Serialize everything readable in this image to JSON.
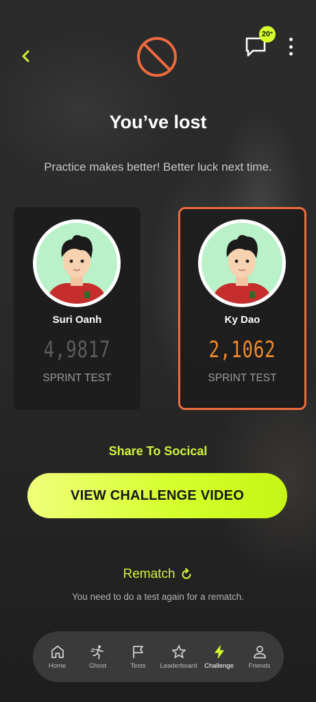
{
  "header": {
    "back_icon": "chevron-left-icon",
    "status_icon": "prohibited-icon",
    "chat_icon": "chat-bubble-icon",
    "chat_badge": "20",
    "chat_badge_sup": "+",
    "menu_icon": "vertical-dots-icon"
  },
  "result": {
    "title": "You’ve lost",
    "subtitle": "Practice makes better! Better luck next time."
  },
  "players": [
    {
      "name": "Suri Oanh",
      "score": "4,9817",
      "label": "SPRINT TEST"
    },
    {
      "name": "Ky Dao",
      "score": "2,1062",
      "label": "SPRINT TEST"
    }
  ],
  "actions": {
    "share": "Share To Socical",
    "view_video": "VIEW CHALLENGE VIDEO",
    "rematch": "Rematch",
    "rematch_note": "You need to do a test again for a rematch."
  },
  "tabs": [
    {
      "label": "Home",
      "icon": "home-icon"
    },
    {
      "label": "Ghost",
      "icon": "ghost-runner-icon"
    },
    {
      "label": "Tests",
      "icon": "flag-icon"
    },
    {
      "label": "Leaderboard",
      "icon": "star-icon"
    },
    {
      "label": "Challenge",
      "icon": "lightning-icon"
    },
    {
      "label": "Friends",
      "icon": "person-icon"
    }
  ],
  "colors": {
    "accent": "#d2f53c",
    "lose": "#ef6b3d",
    "score_highlight": "#f08a2a",
    "background": "#232323"
  }
}
